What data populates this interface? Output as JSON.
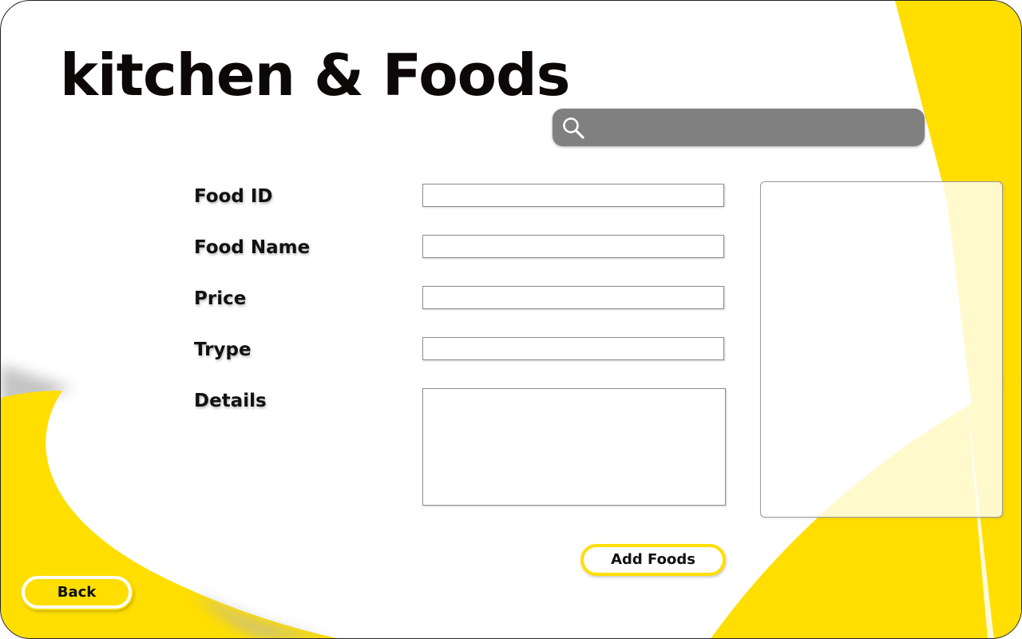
{
  "app": {
    "title": "kitchen & Foods"
  },
  "search": {
    "placeholder": "",
    "value": "",
    "icon": "search-icon"
  },
  "form": {
    "fields": [
      {
        "label": "Food ID",
        "value": ""
      },
      {
        "label": "Food Name",
        "value": ""
      },
      {
        "label": "Price",
        "value": ""
      },
      {
        "label": "Trype",
        "value": ""
      },
      {
        "label": "Details",
        "value": ""
      }
    ]
  },
  "buttons": {
    "add_foods": "Add Foods",
    "back": "Back"
  },
  "theme": {
    "accent": "#FFDE00",
    "search_bg": "#808080",
    "title_color": "#0d0808"
  }
}
